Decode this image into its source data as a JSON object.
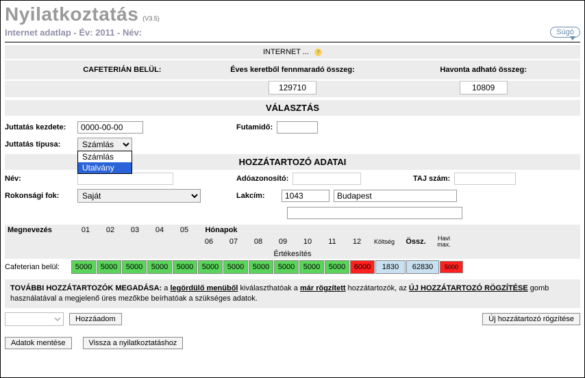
{
  "title": "Nyilatkoztatás",
  "version": "(V3.5)",
  "subtitle_prefix": "Internet adatlap - Év: 2011 - Név:",
  "help_label": "Súgó",
  "internet_line": "INTERNET ...",
  "headers": {
    "cafeteria_inside": "CAFETERIÁN BELÜL:",
    "remaining": "Éves keretből fennmaradó összeg:",
    "monthly": "Havonta adható összeg:"
  },
  "amounts": {
    "remaining": "129710",
    "monthly": "10809"
  },
  "section_select": "VÁLASZTÁS",
  "labels": {
    "start": "Juttatás kezdete:",
    "runtime": "Futamidő:",
    "type": "Juttatás típusa:",
    "name": "Név:",
    "taxid": "Adóazonosító:",
    "taj": "TAJ szám:",
    "kinship": "Rokonsági fok:",
    "address": "Lakcím:"
  },
  "values": {
    "start": "0000-00-00",
    "runtime": "",
    "type_selected": "Számlás",
    "name": "",
    "taxid": "",
    "taj": "",
    "kinship": "Saját",
    "addr_zip": "1043",
    "addr_city": "Budapest",
    "addr_street": ""
  },
  "type_options": [
    "Számlás",
    "Utalvány"
  ],
  "section_family": "HOZZÁTARTOZÓ ADATAI",
  "months_title": "Hónapok",
  "table": {
    "meg": "Megnevezés",
    "months": [
      "01",
      "02",
      "03",
      "04",
      "05",
      "06",
      "07",
      "08",
      "09",
      "10",
      "11",
      "12"
    ],
    "cost": "Költség",
    "sum": "Össz.",
    "havi": "Havi max.",
    "val_label": "Értékesítés",
    "row_label": "Cafeterian belül:",
    "row_values": [
      "5000",
      "5000",
      "5000",
      "5000",
      "5000",
      "5000",
      "5000",
      "5000",
      "5000",
      "5000",
      "5000",
      "6000"
    ],
    "row_cost": "1830",
    "row_sum": "62830",
    "row_havi": "5000"
  },
  "note": {
    "lead": "TOVÁBBI HOZZÁTARTOZÓK MEGADÁSA:",
    "part1": "a ",
    "u1": "legördülő menüből",
    "part2": " kiválaszthatóak a ",
    "u2": "már rögzített",
    "part3": " hozzátartozók, az ",
    "u3": "ÚJ HOZZÁTARTOZÓ RÖGZÍTÉSE",
    "part4": " gomb használatával a megjelenő üres mezőkbe beírhatóak a szükséges adatok."
  },
  "buttons": {
    "add": "Hozzáadom",
    "new_relative": "Új hozzátartozó rögzítése",
    "save": "Adatok mentése",
    "back": "Vissza a nyilatkoztatáshoz"
  }
}
